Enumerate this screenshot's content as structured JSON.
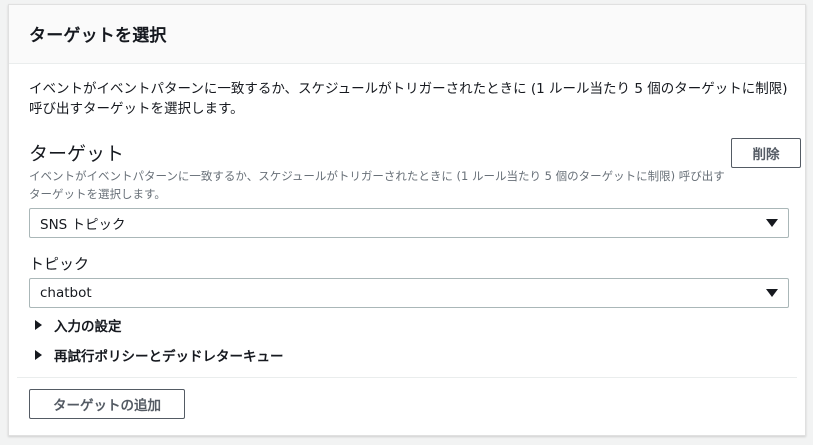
{
  "header": {
    "title": "ターゲットを選択"
  },
  "description": "イベントがイベントパターンに一致するか、スケジュールがトリガーされたときに (1 ルール当たり 5 個のターゲットに制限) 呼び出すターゲットを選択します。",
  "target": {
    "label": "ターゲット",
    "hint": "イベントがイベントパターンに一致するか、スケジュールがトリガーされたときに (1 ルール当たり 5 個のターゲットに制限) 呼び出すターゲットを選択します。",
    "delete_label": "削除",
    "selected": "SNS トピック"
  },
  "topic": {
    "label": "トピック",
    "selected": "chatbot"
  },
  "expanders": {
    "input": "入力の設定",
    "retry": "再試行ポリシーとデッドレターキュー"
  },
  "footer": {
    "add_label": "ターゲットの追加"
  }
}
